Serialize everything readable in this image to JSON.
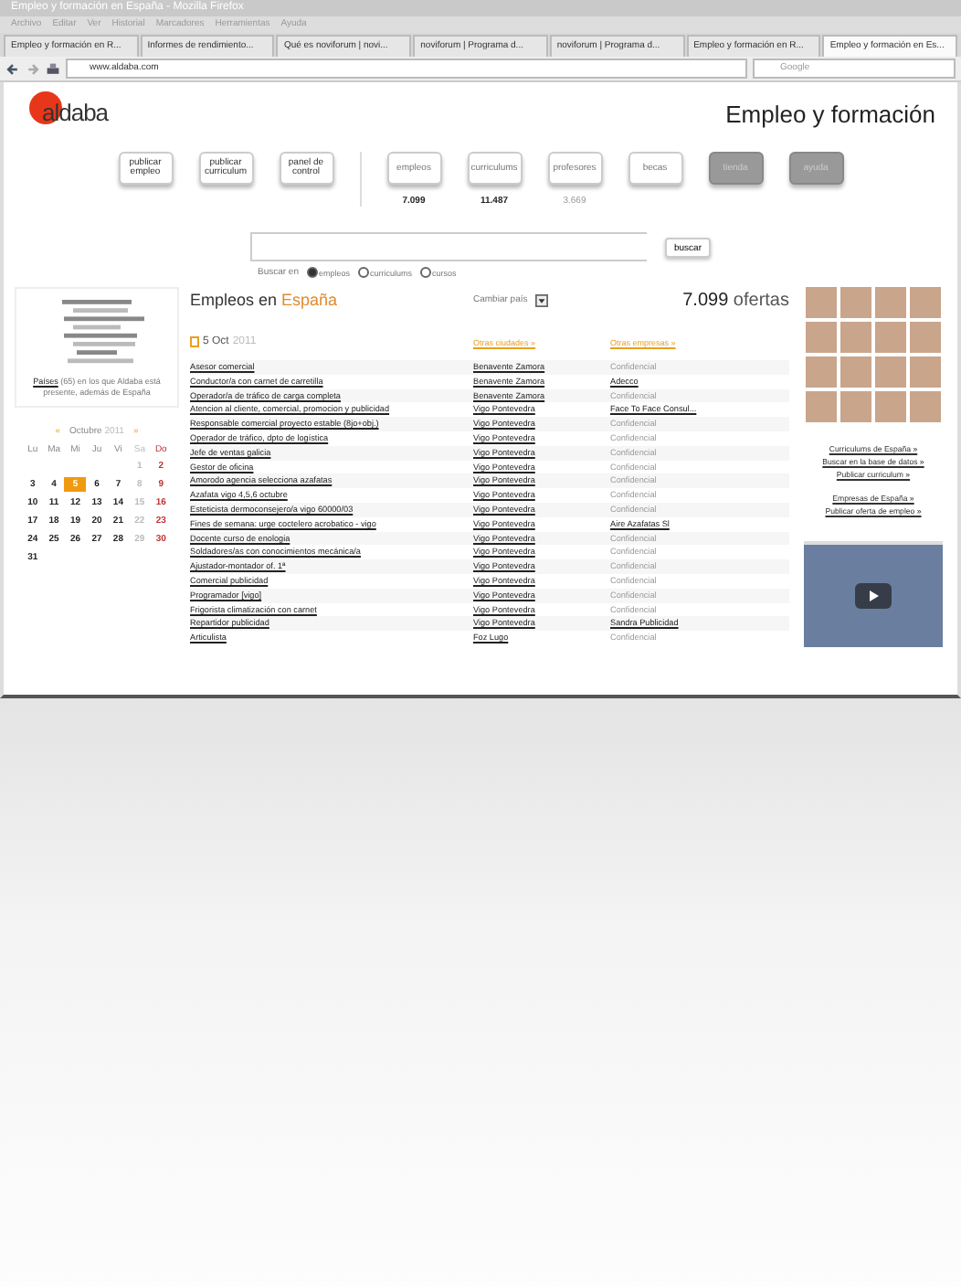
{
  "window": {
    "title": "Empleo y formación en España - Mozilla Firefox"
  },
  "menu": [
    "Archivo",
    "Editar",
    "Ver",
    "Historial",
    "Marcadores",
    "Herramientas",
    "Ayuda"
  ],
  "browser_tabs": [
    {
      "label": "Empleo y formación en R...",
      "selected": false
    },
    {
      "label": "Informes de rendimiento...",
      "selected": false
    },
    {
      "label": "Qué es noviforum | novi...",
      "selected": false
    },
    {
      "label": "noviforum | Programa d...",
      "selected": false
    },
    {
      "label": "noviforum | Programa d...",
      "selected": false
    },
    {
      "label": "Empleo y formación en R...",
      "selected": false
    },
    {
      "label": "Empleo y formación en Es...",
      "selected": true
    }
  ],
  "address": {
    "value": "www.aldaba.com"
  },
  "web_search": {
    "placeholder": "Google"
  },
  "site": {
    "logo": "aldaba",
    "tagline": "Empleo y formación"
  },
  "nav": [
    {
      "label": "publicar empleo",
      "kind": "action",
      "disabled": false
    },
    {
      "label": "publicar curriculum",
      "kind": "action",
      "disabled": false
    },
    {
      "label": "panel de control",
      "kind": "action",
      "disabled": false
    },
    {
      "label": "empleos",
      "kind": "section",
      "disabled": false,
      "count": "7.099",
      "count_muted": false
    },
    {
      "label": "curriculums",
      "kind": "section",
      "disabled": false,
      "count": "11.487",
      "count_muted": false
    },
    {
      "label": "profesores",
      "kind": "section",
      "disabled": false,
      "count": "3.669",
      "count_muted": true
    },
    {
      "label": "becas",
      "kind": "section",
      "disabled": false
    },
    {
      "label": "tienda",
      "kind": "section",
      "disabled": true
    },
    {
      "label": "ayuda",
      "kind": "section",
      "disabled": true
    }
  ],
  "search": {
    "button": "buscar",
    "scope_label": "Buscar en",
    "scopes": [
      {
        "label": "empleos",
        "selected": true
      },
      {
        "label": "curriculums",
        "selected": false
      },
      {
        "label": "cursos",
        "selected": false
      }
    ]
  },
  "countries_box": {
    "link": "Países",
    "caption": "(65) en los que Aldaba está presente, además de España"
  },
  "calendar": {
    "prev": "«",
    "month": "Octubre",
    "year": "2011",
    "next": "»",
    "weekdays": [
      "Lu",
      "Ma",
      "Mi",
      "Ju",
      "Vi",
      "Sa",
      "Do"
    ],
    "weeks": [
      [
        {
          "day": "1",
          "selected": false
        },
        {
          "day": "2",
          "selected": false
        }
      ],
      [
        {
          "day": "3",
          "selected": false
        },
        {
          "day": "4",
          "selected": false
        },
        {
          "day": "5",
          "selected": true
        },
        {
          "day": "6",
          "selected": false
        },
        {
          "day": "7",
          "selected": false
        },
        {
          "day": "8",
          "selected": false
        },
        {
          "day": "9",
          "selected": false
        }
      ],
      [
        {
          "day": "10",
          "selected": false
        },
        {
          "day": "11",
          "selected": false
        },
        {
          "day": "12",
          "selected": false
        },
        {
          "day": "13",
          "selected": false
        },
        {
          "day": "14",
          "selected": false
        },
        {
          "day": "15",
          "selected": false
        },
        {
          "day": "16",
          "selected": false
        }
      ],
      [
        {
          "day": "17",
          "selected": false
        },
        {
          "day": "18",
          "selected": false
        },
        {
          "day": "19",
          "selected": false
        },
        {
          "day": "20",
          "selected": false
        },
        {
          "day": "21",
          "selected": false
        },
        {
          "day": "22",
          "selected": false
        },
        {
          "day": "23",
          "selected": false
        }
      ],
      [
        {
          "day": "24",
          "selected": false
        },
        {
          "day": "25",
          "selected": false
        },
        {
          "day": "26",
          "selected": false
        },
        {
          "day": "27",
          "selected": false
        },
        {
          "day": "28",
          "selected": false
        },
        {
          "day": "29",
          "selected": false
        },
        {
          "day": "30",
          "selected": false
        }
      ],
      [
        {
          "day": "31",
          "selected": false
        }
      ]
    ]
  },
  "listing": {
    "title": "Empleos en",
    "country": "España",
    "change_country": "Cambiar país",
    "count": "7.099",
    "count_label": "ofertas",
    "date": "5 Oct",
    "date_year": "2011",
    "cities_link": "Otras ciudades »",
    "companies_link": "Otras empresas »",
    "rows": [
      {
        "job": "Asesor comercial",
        "city": "Benavente Zamora",
        "company": "Confidencial",
        "company_linked": false
      },
      {
        "job": "Conductor/a con carnet de carretilla",
        "city": "Benavente Zamora",
        "company": "Adecco",
        "company_linked": true
      },
      {
        "job": "Operador/a de tráfico de carga completa",
        "city": "Benavente Zamora",
        "company": "Confidencial",
        "company_linked": false
      },
      {
        "job": "Atencion al cliente, comercial, promocion y publicidad",
        "city": "Vigo Pontevedra",
        "company": "Face To Face Consul...",
        "company_linked": true
      },
      {
        "job": "Responsable comercial proyecto estable (8jo+obj.)",
        "city": "Vigo Pontevedra",
        "company": "Confidencial",
        "company_linked": false
      },
      {
        "job": "Operador de tráfico, dpto de logística",
        "city": "Vigo Pontevedra",
        "company": "Confidencial",
        "company_linked": false
      },
      {
        "job": "Jefe de ventas galicia",
        "city": "Vigo Pontevedra",
        "company": "Confidencial",
        "company_linked": false
      },
      {
        "job": "Gestor de oficina",
        "city": "Vigo Pontevedra",
        "company": "Confidencial",
        "company_linked": false
      },
      {
        "job": "Amorodo agencia selecciona azafatas",
        "city": "Vigo Pontevedra",
        "company": "Confidencial",
        "company_linked": false
      },
      {
        "job": "Azafata vigo 4,5,6 octubre",
        "city": "Vigo Pontevedra",
        "company": "Confidencial",
        "company_linked": false
      },
      {
        "job": "Esteticista dermoconsejero/a vigo 60000/03",
        "city": "Vigo Pontevedra",
        "company": "Confidencial",
        "company_linked": false
      },
      {
        "job": "Fines de semana: urge coctelero acrobatico - vigo",
        "city": "Vigo Pontevedra",
        "company": "Aire Azafatas Sl",
        "company_linked": true
      },
      {
        "job": "Docente curso de enologia",
        "city": "Vigo Pontevedra",
        "company": "Confidencial",
        "company_linked": false
      },
      {
        "job": "Soldadores/as con conocimientos mecánica/a",
        "city": "Vigo Pontevedra",
        "company": "Confidencial",
        "company_linked": false
      },
      {
        "job": "Ajustador-montador of. 1ª",
        "city": "Vigo Pontevedra",
        "company": "Confidencial",
        "company_linked": false
      },
      {
        "job": "Comercial publicidad",
        "city": "Vigo Pontevedra",
        "company": "Confidencial",
        "company_linked": false
      },
      {
        "job": "Programador [vigo]",
        "city": "Vigo Pontevedra",
        "company": "Confidencial",
        "company_linked": false
      },
      {
        "job": "Frigorista climatización con carnet",
        "city": "Vigo Pontevedra",
        "company": "Confidencial",
        "company_linked": false
      },
      {
        "job": "Repartidor publicidad",
        "city": "Vigo Pontevedra",
        "company": "Sandra Publicidad",
        "company_linked": true
      },
      {
        "job": "Articulista",
        "city": "Foz Lugo",
        "company": "Confidencial",
        "company_linked": false
      }
    ]
  },
  "side_links": [
    [
      "Curriculums de España »",
      "Buscar en la base de datos »",
      "Publicar curriculum »"
    ],
    [
      "Empresas de España »",
      "Publicar oferta de empleo »"
    ]
  ]
}
